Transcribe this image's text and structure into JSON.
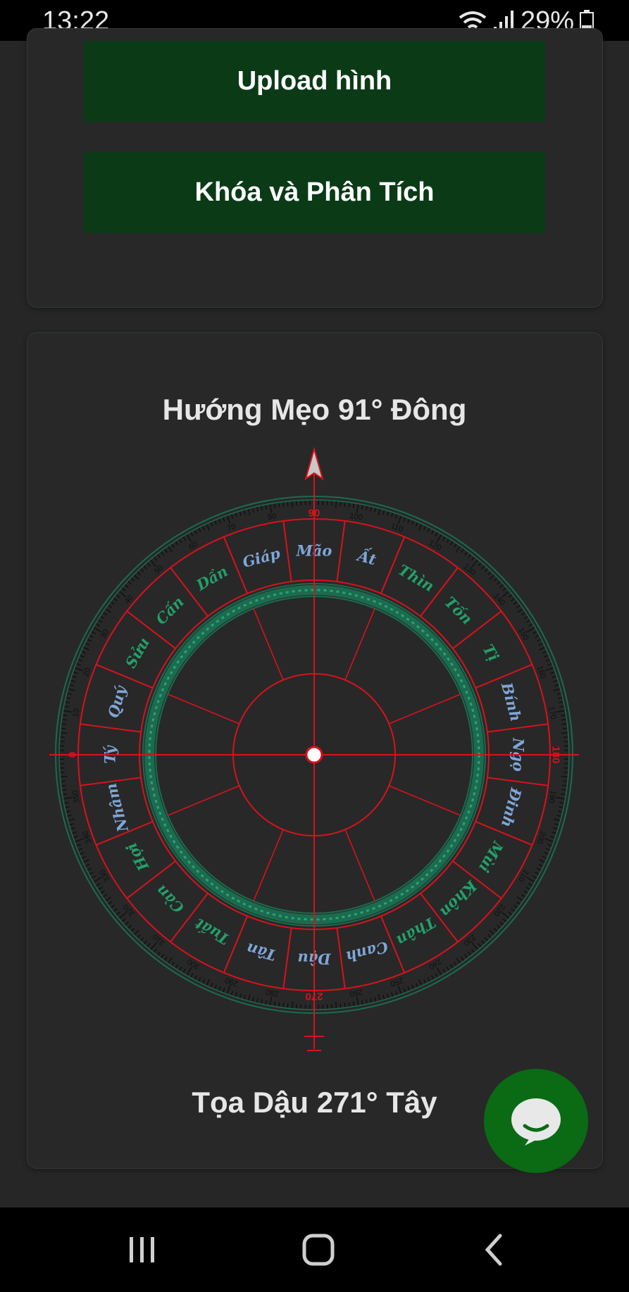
{
  "status_bar": {
    "time": "13:22",
    "battery": "29%",
    "icons": [
      "wifi-icon",
      "signal-icon",
      "battery-icon"
    ]
  },
  "buttons": {
    "upload": "Upload hình",
    "lock_analyze": "Khóa và Phân Tích"
  },
  "compass": {
    "heading_text": "Hướng Mẹo 91° Đông",
    "seat_text": "Tọa Dậu 271° Tây",
    "heading_degrees": 91,
    "cardinal_labels": [
      "0",
      "90",
      "180",
      "270"
    ],
    "mountains": [
      {
        "name": "Mão",
        "color": "#7fa6d8"
      },
      {
        "name": "Ất",
        "color": "#7fa6d8"
      },
      {
        "name": "Thìn",
        "color": "#22a06b"
      },
      {
        "name": "Tốn",
        "color": "#22a06b"
      },
      {
        "name": "Tị",
        "color": "#22a06b"
      },
      {
        "name": "Bính",
        "color": "#7fa6d8"
      },
      {
        "name": "Ngọ",
        "color": "#7fa6d8"
      },
      {
        "name": "Đinh",
        "color": "#7fa6d8"
      },
      {
        "name": "Mùi",
        "color": "#22a06b"
      },
      {
        "name": "Khôn",
        "color": "#22a06b"
      },
      {
        "name": "Thân",
        "color": "#22a06b"
      },
      {
        "name": "Canh",
        "color": "#7fa6d8"
      },
      {
        "name": "Dậu",
        "color": "#7fa6d8"
      },
      {
        "name": "Tân",
        "color": "#7fa6d8"
      },
      {
        "name": "Tuất",
        "color": "#22a06b"
      },
      {
        "name": "Càn",
        "color": "#22a06b"
      },
      {
        "name": "Hợi",
        "color": "#22a06b"
      },
      {
        "name": "Nhâm",
        "color": "#7fa6d8"
      },
      {
        "name": "Tý",
        "color": "#7fa6d8"
      },
      {
        "name": "Quý",
        "color": "#7fa6d8"
      },
      {
        "name": "Sửu",
        "color": "#22a06b"
      },
      {
        "name": "Cấn",
        "color": "#22a06b"
      },
      {
        "name": "Dần",
        "color": "#22a06b"
      },
      {
        "name": "Giáp",
        "color": "#7fa6d8"
      }
    ],
    "colors": {
      "red": "#d8121c",
      "green": "#1b6b4f",
      "tick": "#101010"
    }
  },
  "fab": {
    "icon": "chat-icon",
    "color": "#0a6b14"
  },
  "nav": {
    "icons": [
      "recent-apps-icon",
      "home-icon",
      "back-icon"
    ]
  }
}
